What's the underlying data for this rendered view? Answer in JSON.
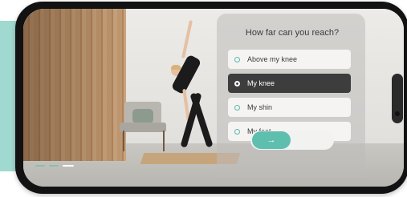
{
  "colors": {
    "accent": "#5fbfaf",
    "selected_option_bg": "#3d3d3d",
    "teal_block": "#9fd9cf"
  },
  "quiz": {
    "question": "How far can you reach?",
    "options": [
      {
        "label": "Above my knee",
        "selected": false
      },
      {
        "label": "My knee",
        "selected": true
      },
      {
        "label": "My shin",
        "selected": false
      },
      {
        "label": "My foot",
        "selected": false
      }
    ],
    "next_icon": "arrow-right-icon",
    "next_label": "→"
  },
  "progress": {
    "segments": 3,
    "active_segment": 3
  }
}
